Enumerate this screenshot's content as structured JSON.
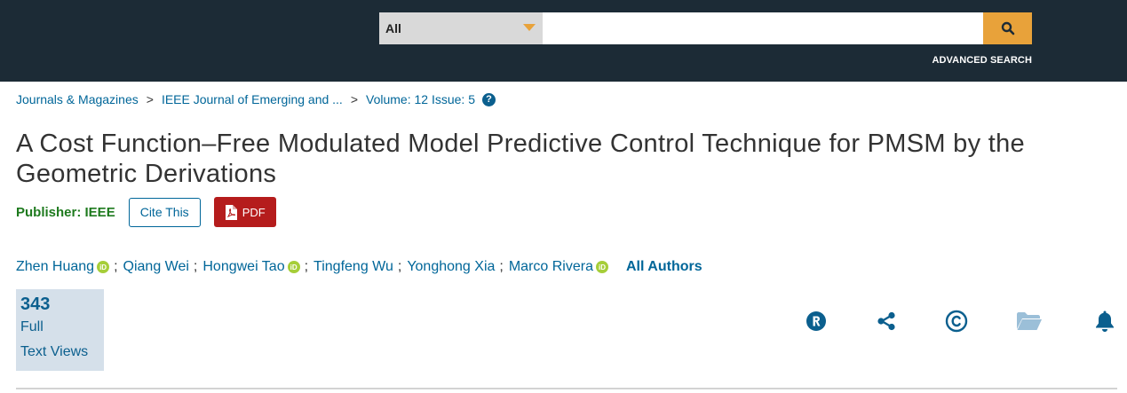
{
  "search": {
    "scope_value": "All",
    "query_value": "",
    "placeholder": "",
    "advanced_label": "ADVANCED SEARCH"
  },
  "breadcrumb": {
    "items": [
      "Journals & Magazines",
      "IEEE Journal of Emerging and ...",
      "Volume: 12 Issue: 5"
    ],
    "separator": ">",
    "help": "?"
  },
  "article": {
    "title": "A Cost Function–Free Modulated Model Predictive Control Technique for PMSM by the Geometric Derivations",
    "publisher_label": "Publisher: IEEE",
    "cite_label": "Cite This",
    "pdf_label": "PDF"
  },
  "authors": {
    "list": [
      {
        "name": "Zhen Huang",
        "orcid": true
      },
      {
        "name": "Qiang Wei",
        "orcid": false
      },
      {
        "name": "Hongwei Tao",
        "orcid": true
      },
      {
        "name": "Tingfeng Wu",
        "orcid": false
      },
      {
        "name": "Yonghong Xia",
        "orcid": false
      },
      {
        "name": "Marco Rivera",
        "orcid": true
      }
    ],
    "separator": ";",
    "orcid_mark": "iD",
    "all_label": "All Authors"
  },
  "metrics": {
    "count": "343",
    "label_line1": "Full",
    "label_line2": "Text Views"
  },
  "actions": [
    {
      "icon": "rights-icon"
    },
    {
      "icon": "share-icon"
    },
    {
      "icon": "copyright-icon"
    },
    {
      "icon": "folder-icon"
    },
    {
      "icon": "bell-icon"
    }
  ],
  "colors": {
    "header_bg": "#1c2b36",
    "accent_orange": "#e8a23a",
    "link_blue": "#006699",
    "publisher_green": "#1e7a1e",
    "pdf_red": "#b51c1c",
    "orcid_green": "#a6ce39"
  }
}
